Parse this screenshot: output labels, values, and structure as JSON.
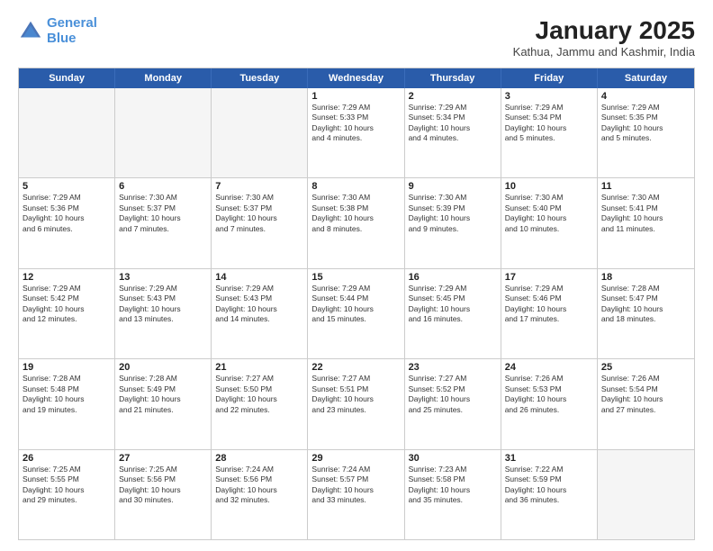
{
  "header": {
    "logo_line1": "General",
    "logo_line2": "Blue",
    "month": "January 2025",
    "location": "Kathua, Jammu and Kashmir, India"
  },
  "weekdays": [
    "Sunday",
    "Monday",
    "Tuesday",
    "Wednesday",
    "Thursday",
    "Friday",
    "Saturday"
  ],
  "rows": [
    [
      {
        "day": "",
        "lines": [],
        "empty": true
      },
      {
        "day": "",
        "lines": [],
        "empty": true
      },
      {
        "day": "",
        "lines": [],
        "empty": true
      },
      {
        "day": "1",
        "lines": [
          "Sunrise: 7:29 AM",
          "Sunset: 5:33 PM",
          "Daylight: 10 hours",
          "and 4 minutes."
        ]
      },
      {
        "day": "2",
        "lines": [
          "Sunrise: 7:29 AM",
          "Sunset: 5:34 PM",
          "Daylight: 10 hours",
          "and 4 minutes."
        ]
      },
      {
        "day": "3",
        "lines": [
          "Sunrise: 7:29 AM",
          "Sunset: 5:34 PM",
          "Daylight: 10 hours",
          "and 5 minutes."
        ]
      },
      {
        "day": "4",
        "lines": [
          "Sunrise: 7:29 AM",
          "Sunset: 5:35 PM",
          "Daylight: 10 hours",
          "and 5 minutes."
        ]
      }
    ],
    [
      {
        "day": "5",
        "lines": [
          "Sunrise: 7:29 AM",
          "Sunset: 5:36 PM",
          "Daylight: 10 hours",
          "and 6 minutes."
        ]
      },
      {
        "day": "6",
        "lines": [
          "Sunrise: 7:30 AM",
          "Sunset: 5:37 PM",
          "Daylight: 10 hours",
          "and 7 minutes."
        ]
      },
      {
        "day": "7",
        "lines": [
          "Sunrise: 7:30 AM",
          "Sunset: 5:37 PM",
          "Daylight: 10 hours",
          "and 7 minutes."
        ]
      },
      {
        "day": "8",
        "lines": [
          "Sunrise: 7:30 AM",
          "Sunset: 5:38 PM",
          "Daylight: 10 hours",
          "and 8 minutes."
        ]
      },
      {
        "day": "9",
        "lines": [
          "Sunrise: 7:30 AM",
          "Sunset: 5:39 PM",
          "Daylight: 10 hours",
          "and 9 minutes."
        ]
      },
      {
        "day": "10",
        "lines": [
          "Sunrise: 7:30 AM",
          "Sunset: 5:40 PM",
          "Daylight: 10 hours",
          "and 10 minutes."
        ]
      },
      {
        "day": "11",
        "lines": [
          "Sunrise: 7:30 AM",
          "Sunset: 5:41 PM",
          "Daylight: 10 hours",
          "and 11 minutes."
        ]
      }
    ],
    [
      {
        "day": "12",
        "lines": [
          "Sunrise: 7:29 AM",
          "Sunset: 5:42 PM",
          "Daylight: 10 hours",
          "and 12 minutes."
        ]
      },
      {
        "day": "13",
        "lines": [
          "Sunrise: 7:29 AM",
          "Sunset: 5:43 PM",
          "Daylight: 10 hours",
          "and 13 minutes."
        ]
      },
      {
        "day": "14",
        "lines": [
          "Sunrise: 7:29 AM",
          "Sunset: 5:43 PM",
          "Daylight: 10 hours",
          "and 14 minutes."
        ]
      },
      {
        "day": "15",
        "lines": [
          "Sunrise: 7:29 AM",
          "Sunset: 5:44 PM",
          "Daylight: 10 hours",
          "and 15 minutes."
        ]
      },
      {
        "day": "16",
        "lines": [
          "Sunrise: 7:29 AM",
          "Sunset: 5:45 PM",
          "Daylight: 10 hours",
          "and 16 minutes."
        ]
      },
      {
        "day": "17",
        "lines": [
          "Sunrise: 7:29 AM",
          "Sunset: 5:46 PM",
          "Daylight: 10 hours",
          "and 17 minutes."
        ]
      },
      {
        "day": "18",
        "lines": [
          "Sunrise: 7:28 AM",
          "Sunset: 5:47 PM",
          "Daylight: 10 hours",
          "and 18 minutes."
        ]
      }
    ],
    [
      {
        "day": "19",
        "lines": [
          "Sunrise: 7:28 AM",
          "Sunset: 5:48 PM",
          "Daylight: 10 hours",
          "and 19 minutes."
        ]
      },
      {
        "day": "20",
        "lines": [
          "Sunrise: 7:28 AM",
          "Sunset: 5:49 PM",
          "Daylight: 10 hours",
          "and 21 minutes."
        ]
      },
      {
        "day": "21",
        "lines": [
          "Sunrise: 7:27 AM",
          "Sunset: 5:50 PM",
          "Daylight: 10 hours",
          "and 22 minutes."
        ]
      },
      {
        "day": "22",
        "lines": [
          "Sunrise: 7:27 AM",
          "Sunset: 5:51 PM",
          "Daylight: 10 hours",
          "and 23 minutes."
        ]
      },
      {
        "day": "23",
        "lines": [
          "Sunrise: 7:27 AM",
          "Sunset: 5:52 PM",
          "Daylight: 10 hours",
          "and 25 minutes."
        ]
      },
      {
        "day": "24",
        "lines": [
          "Sunrise: 7:26 AM",
          "Sunset: 5:53 PM",
          "Daylight: 10 hours",
          "and 26 minutes."
        ]
      },
      {
        "day": "25",
        "lines": [
          "Sunrise: 7:26 AM",
          "Sunset: 5:54 PM",
          "Daylight: 10 hours",
          "and 27 minutes."
        ]
      }
    ],
    [
      {
        "day": "26",
        "lines": [
          "Sunrise: 7:25 AM",
          "Sunset: 5:55 PM",
          "Daylight: 10 hours",
          "and 29 minutes."
        ]
      },
      {
        "day": "27",
        "lines": [
          "Sunrise: 7:25 AM",
          "Sunset: 5:56 PM",
          "Daylight: 10 hours",
          "and 30 minutes."
        ]
      },
      {
        "day": "28",
        "lines": [
          "Sunrise: 7:24 AM",
          "Sunset: 5:56 PM",
          "Daylight: 10 hours",
          "and 32 minutes."
        ]
      },
      {
        "day": "29",
        "lines": [
          "Sunrise: 7:24 AM",
          "Sunset: 5:57 PM",
          "Daylight: 10 hours",
          "and 33 minutes."
        ]
      },
      {
        "day": "30",
        "lines": [
          "Sunrise: 7:23 AM",
          "Sunset: 5:58 PM",
          "Daylight: 10 hours",
          "and 35 minutes."
        ]
      },
      {
        "day": "31",
        "lines": [
          "Sunrise: 7:22 AM",
          "Sunset: 5:59 PM",
          "Daylight: 10 hours",
          "and 36 minutes."
        ]
      },
      {
        "day": "",
        "lines": [],
        "empty": true
      }
    ]
  ]
}
